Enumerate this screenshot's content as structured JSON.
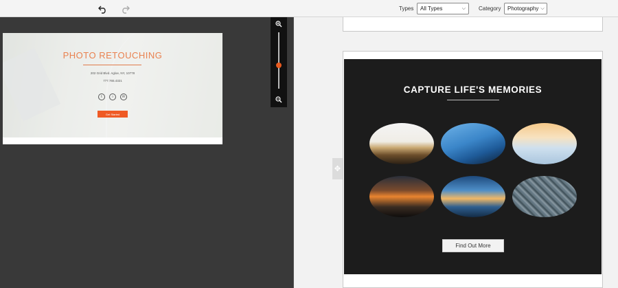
{
  "toolbar": {
    "undo_icon": "undo-icon",
    "redo_icon": "redo-icon",
    "types_label": "Types",
    "types_value": "All Types",
    "category_label": "Category",
    "category_value": "Photography"
  },
  "preview": {
    "title": "PHOTO RETOUCHING",
    "address": "202 Grid Blvd. Agloe, NY, 10778",
    "phone": "777.765.4321",
    "social": [
      "twitter-icon",
      "instagram-icon",
      "email-icon"
    ],
    "button_label": "Get Started"
  },
  "zoom": {
    "level_fraction": 0.55
  },
  "template_card": {
    "title": "CAPTURE LIFE'S MEMORIES",
    "photos": [
      "sunset-over-hills",
      "meteor-shower-sky",
      "ocean-sunrise",
      "fiery-sunset-rocks",
      "lake-dusk",
      "aerial-city"
    ],
    "button_label": "Find Out More"
  },
  "colors": {
    "accent": "#e85a1f",
    "dark": "#1c1c1c"
  }
}
